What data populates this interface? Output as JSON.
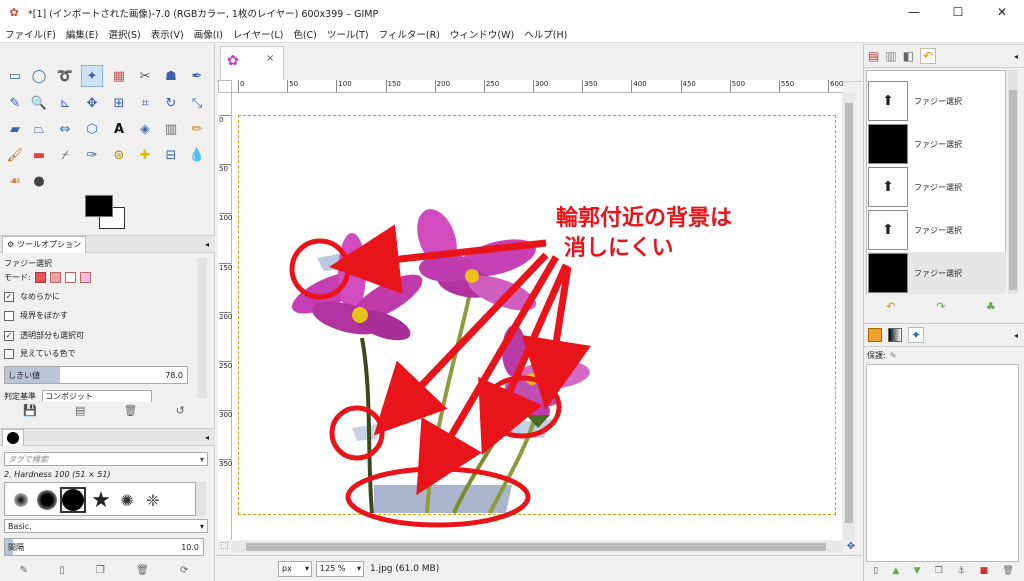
{
  "window": {
    "title": "*[1] (インポートされた画像)-7.0 (RGBカラー, 1枚のレイヤー) 600x399 – GIMP",
    "app_icon": "gimp-icon",
    "controls": [
      "minimize",
      "maximize",
      "close"
    ]
  },
  "menu": [
    "ファイル(F)",
    "編集(E)",
    "選択(S)",
    "表示(V)",
    "画像(I)",
    "レイヤー(L)",
    "色(C)",
    "ツール(T)",
    "フィルター(R)",
    "ウィンドウ(W)",
    "ヘルプ(H)"
  ],
  "tool_options": {
    "tab_label": "ツールオプション",
    "tool_name": "ファジー選択",
    "mode_label": "モード:",
    "antialias": {
      "label": "なめらかに",
      "checked": true
    },
    "feather": {
      "label": "境界をぼかす",
      "checked": false
    },
    "select_transparent": {
      "label": "透明部分も選択可",
      "checked": true
    },
    "sample_merged": {
      "label": "見えている色で",
      "checked": false
    },
    "threshold": {
      "label": "しきい値",
      "value": "78.0",
      "fill_fraction": 0.3
    },
    "criterion": {
      "label": "判定基準",
      "value": "コンポジット"
    }
  },
  "brushes": {
    "filter_placeholder": "タグで検索",
    "selected_brush": "2. Hardness 100 (51 × 51)",
    "preset": "Basic,",
    "spacing": {
      "label": "間隔",
      "value": "10.0"
    }
  },
  "image_tab": {
    "close": "×"
  },
  "ruler": {
    "top_labels": [
      "0",
      "50",
      "100",
      "150",
      "200",
      "250",
      "300",
      "350",
      "400",
      "450",
      "500",
      "550",
      "600"
    ],
    "left_labels": [
      "0",
      "50",
      "100",
      "150",
      "200",
      "250",
      "300",
      "350"
    ]
  },
  "status": {
    "unit": "px",
    "zoom": "125 %",
    "file_info": "1.jpg (61.0 MB)"
  },
  "annotation": {
    "line1": "輪郭付近の背景は",
    "line2": "消しにくい",
    "color": "#e8141a"
  },
  "undo_history": [
    {
      "label": "ファジー選択",
      "thumb": "dark"
    },
    {
      "label": "ファジー選択",
      "thumb": "black"
    },
    {
      "label": "ファジー選択",
      "thumb": "dark"
    },
    {
      "label": "ファジー選択",
      "thumb": "dark"
    },
    {
      "label": "ファジー選択",
      "thumb": "black"
    }
  ],
  "layers_panel": {
    "lock_label": "保護:"
  },
  "colors": {
    "accent": "#e8141a",
    "selection": "#c6a800",
    "flower": "#d24bbf"
  }
}
